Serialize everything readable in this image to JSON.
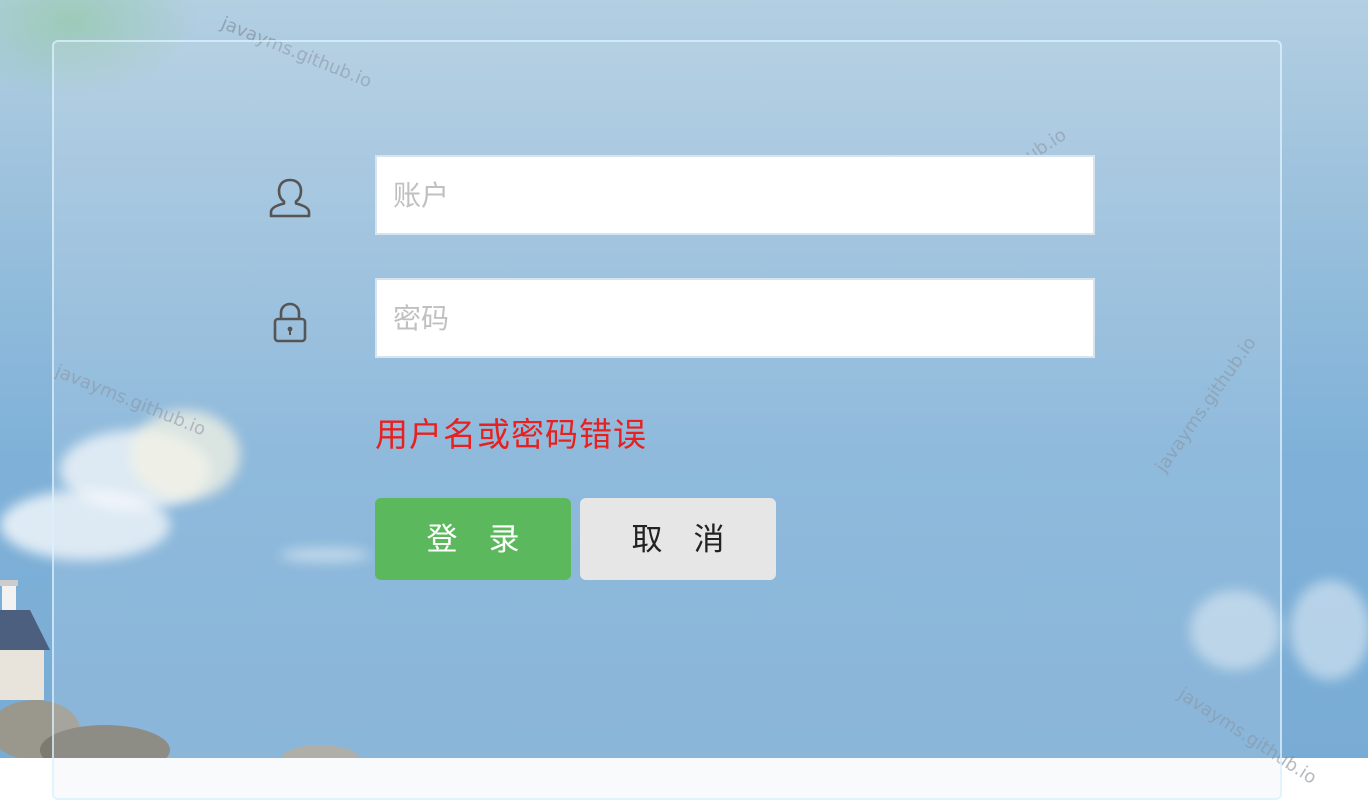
{
  "form": {
    "username": {
      "value": "",
      "placeholder": "账户",
      "icon": "user-icon"
    },
    "password": {
      "value": "",
      "placeholder": "密码",
      "icon": "lock-icon"
    },
    "error_message": "用户名或密码错误",
    "login_label": "登　录",
    "cancel_label": "取　消"
  },
  "watermark_text": "javayms.github.io",
  "colors": {
    "login_button": "#5cb85c",
    "cancel_button": "#e6e6e6",
    "error_text": "#e8201f",
    "icon_stroke": "#555555"
  }
}
